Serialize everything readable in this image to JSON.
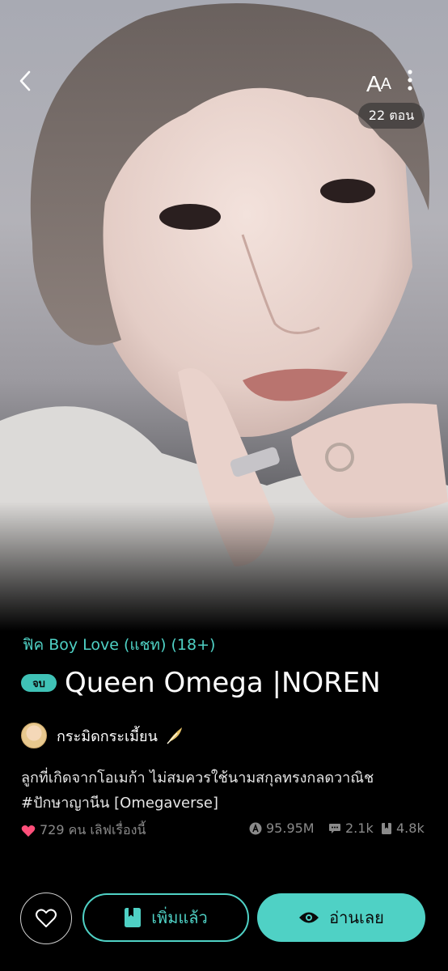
{
  "header": {
    "font_size_label": "A",
    "font_size_label_small": "A",
    "episode_count": "22 ตอน"
  },
  "story": {
    "category": "ฟิค Boy Love (แชท) (18+)",
    "status_badge": "จบ",
    "title": "Queen Omega |NOREN",
    "author": "กระมิดกระเมี้ยน",
    "description_line1": "ลูกที่เกิดจากโอเมก้า ไม่สมควรใช้นามสกุลทรงกลดวาณิช",
    "description_line2": "#ปักษาญานีน [Omegaverse]"
  },
  "stats": {
    "love": "729 คน เลิฟเรื่องนี้",
    "views": "95.95M",
    "comments": "2.1k",
    "saves": "4.8k"
  },
  "actions": {
    "added_label": "เพิ่มแล้ว",
    "read_label": "อ่านเลย"
  },
  "colors": {
    "accent": "#4fd1c5",
    "love": "#ff4f7a",
    "background": "#000000"
  }
}
